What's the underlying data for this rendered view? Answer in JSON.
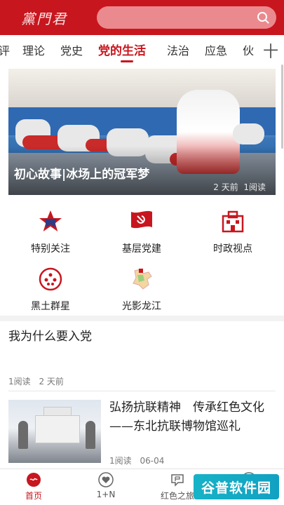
{
  "header": {
    "logo_text": "黨門君",
    "search": {
      "placeholder": ""
    }
  },
  "tabs": [
    {
      "label": "评"
    },
    {
      "label": "理论"
    },
    {
      "label": "党史"
    },
    {
      "label": "党的生活",
      "active": true
    },
    {
      "label": "法治"
    },
    {
      "label": "应急"
    },
    {
      "label": "伙"
    }
  ],
  "tab_more": "十",
  "banner": {
    "title": "初心故事|冰场上的冠军梦",
    "time": "2 天前",
    "reads": "1阅读"
  },
  "shortcuts": [
    {
      "label": "特别关注",
      "icon": "star-icon"
    },
    {
      "label": "基层党建",
      "icon": "party-flag-icon"
    },
    {
      "label": "时政视点",
      "icon": "building-icon"
    },
    {
      "label": "黑土群星",
      "icon": "stars-circle-icon"
    },
    {
      "label": "光影龙江",
      "icon": "province-map-icon"
    }
  ],
  "articles": [
    {
      "title": "我为什么要入党",
      "reads": "1阅读",
      "time": "2 天前"
    },
    {
      "title": "弘扬抗联精神　传承红色文化——东北抗联博物馆巡礼",
      "reads": "1阅读",
      "time": "06-04"
    }
  ],
  "bottom_nav": [
    {
      "label": "首页",
      "icon": "home-logo-icon",
      "active": true
    },
    {
      "label": "1+N",
      "icon": "heart-icon"
    },
    {
      "label": "红色之旅",
      "icon": "flag-bubble-icon"
    },
    {
      "label": "",
      "icon": "circle-icon"
    },
    {
      "label": "",
      "icon": "user-icon"
    }
  ],
  "watermark": "谷普软件园",
  "colors": {
    "brand": "#c8161e",
    "search_bg": "#ea8a8e",
    "muted": "#777777"
  }
}
